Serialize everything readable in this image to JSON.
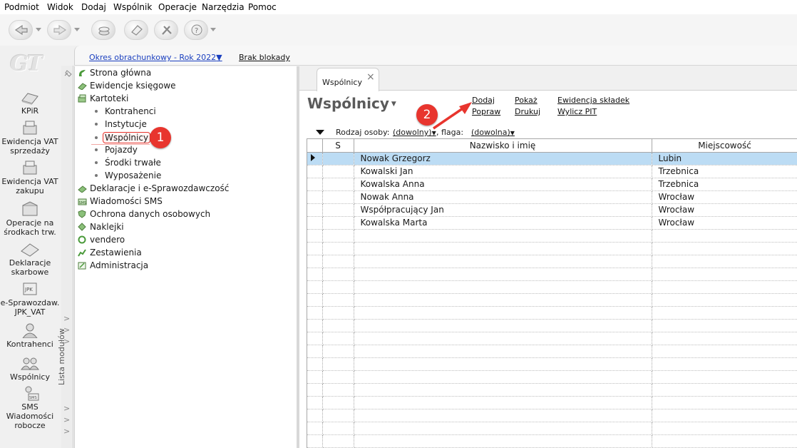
{
  "menu": [
    "Podmiot",
    "Widok",
    "Dodaj",
    "Wspólnik",
    "Operacje",
    "Narzędzia",
    "Pomoc"
  ],
  "logo_text": "GT",
  "modules": [
    {
      "label": "KPiR",
      "icon": "kpir-icon"
    },
    {
      "label": "Ewidencja VAT sprzedaży",
      "icon": "vat-sales-icon"
    },
    {
      "label": "Ewidencja VAT zakupu",
      "icon": "vat-purchase-icon"
    },
    {
      "label": "Operacje na środkach trw.",
      "icon": "fixed-assets-icon"
    },
    {
      "label": "Deklaracje skarbowe",
      "icon": "tax-declarations-icon"
    },
    {
      "label": "e-Sprawozdaw. JPK_VAT",
      "icon": "jpk-icon"
    },
    {
      "label": "Kontrahenci",
      "icon": "contractor-icon"
    },
    {
      "label": "Wspólnicy",
      "icon": "partners-icon"
    },
    {
      "label": "SMS Wiadomości robocze",
      "icon": "sms-icon"
    }
  ],
  "module_list_label": "Lista modułów",
  "top_strip": {
    "period": "Okres obrachunkowy - Rok 2022",
    "lock_status": "Brak blokady"
  },
  "tree": [
    {
      "label": "Strona główna",
      "level": 0,
      "icon": "home-icon"
    },
    {
      "label": "Ewidencje księgowe",
      "level": 0,
      "icon": "ledger-icon"
    },
    {
      "label": "Kartoteki",
      "level": 0,
      "icon": "files-icon"
    },
    {
      "label": "Kontrahenci",
      "level": 1
    },
    {
      "label": "Instytucje",
      "level": 1
    },
    {
      "label": "Wspólnicy",
      "level": 1
    },
    {
      "label": "Pojazdy",
      "level": 1
    },
    {
      "label": "Środki trwałe",
      "level": 1
    },
    {
      "label": "Wyposażenie",
      "level": 1
    },
    {
      "label": "Deklaracje i e-Sprawozdawczość",
      "level": 0,
      "icon": "declaration-icon"
    },
    {
      "label": "Wiadomości SMS",
      "level": 0,
      "icon": "sms-icon"
    },
    {
      "label": "Ochrona danych osobowych",
      "level": 0,
      "icon": "shield-icon"
    },
    {
      "label": "Naklejki",
      "level": 0,
      "icon": "sticker-icon"
    },
    {
      "label": "vendero",
      "level": 0,
      "icon": "vendero-icon"
    },
    {
      "label": "Zestawienia",
      "level": 0,
      "icon": "report-icon"
    },
    {
      "label": "Administracja",
      "level": 0,
      "icon": "admin-icon"
    }
  ],
  "tab": {
    "label": "Wspólnicy",
    "close": "×"
  },
  "panel": {
    "title": "Wspólnicy",
    "actions": {
      "dodaj": "Dodaj",
      "popraw": "Popraw",
      "pokaz": "Pokaż",
      "drukuj": "Drukuj",
      "ewidencja": "Ewidencja składek",
      "wylicz": "Wylicz PIT"
    },
    "filter": {
      "rodzaj_label": "Rodzaj osoby:",
      "rodzaj_value": "(dowolny)",
      "flaga_label": ", flaga:",
      "flaga_value": "(dowolna)"
    }
  },
  "table": {
    "columns": [
      "",
      "S",
      "Nazwisko i imię",
      "Miejscowość"
    ],
    "rows": [
      {
        "name": "Nowak Grzegorz",
        "city": "Lubin"
      },
      {
        "name": "Kowalski Jan",
        "city": "Trzebnica"
      },
      {
        "name": "Kowalska Anna",
        "city": "Trzebnica"
      },
      {
        "name": "Nowak Anna",
        "city": "Wrocław"
      },
      {
        "name": "Współpracujący Jan",
        "city": "Wrocław"
      },
      {
        "name": "Kowalska Marta",
        "city": "Wrocław"
      }
    ]
  },
  "callouts": [
    "1",
    "2"
  ],
  "colors": {
    "accent": "#e8352e",
    "link": "#1a3fbf",
    "selected_row": "#bcdcf4"
  }
}
